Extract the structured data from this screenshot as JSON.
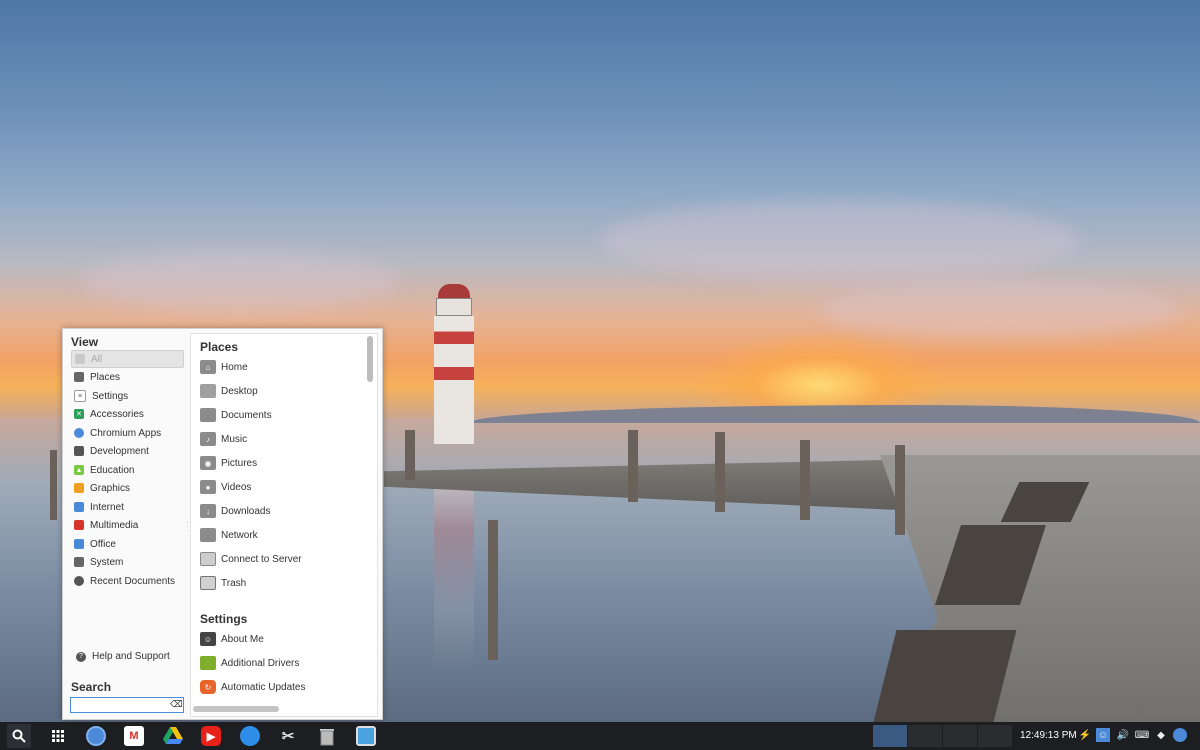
{
  "menu": {
    "view_title": "View",
    "view_items": [
      {
        "label": "All",
        "icon": "all-icon",
        "color": "#c9c9c9"
      },
      {
        "label": "Places",
        "icon": "folder-icon",
        "color": "#666666"
      },
      {
        "label": "Settings",
        "icon": "settings-icon",
        "color": "#8a8a8a"
      },
      {
        "label": "Accessories",
        "icon": "accessories-icon",
        "color": "#2e9e5b"
      },
      {
        "label": "Chromium Apps",
        "icon": "chromium-icon",
        "color": "#4a8ad9"
      },
      {
        "label": "Development",
        "icon": "development-icon",
        "color": "#555555"
      },
      {
        "label": "Education",
        "icon": "education-icon",
        "color": "#7ac943"
      },
      {
        "label": "Graphics",
        "icon": "graphics-icon",
        "color": "#f0a020"
      },
      {
        "label": "Internet",
        "icon": "internet-icon",
        "color": "#4a8ad9"
      },
      {
        "label": "Multimedia",
        "icon": "multimedia-icon",
        "color": "#d9342b"
      },
      {
        "label": "Office",
        "icon": "office-icon",
        "color": "#4a8ad9"
      },
      {
        "label": "System",
        "icon": "system-icon",
        "color": "#666666"
      },
      {
        "label": "Recent Documents",
        "icon": "recent-icon",
        "color": "#555555"
      }
    ],
    "help_label": "Help and Support",
    "search_label": "Search",
    "search_value": "",
    "places_title": "Places",
    "places": [
      {
        "label": "Home",
        "icon": "home-icon"
      },
      {
        "label": "Desktop",
        "icon": "desktop-icon"
      },
      {
        "label": "Documents",
        "icon": "documents-icon"
      },
      {
        "label": "Music",
        "icon": "music-icon"
      },
      {
        "label": "Pictures",
        "icon": "pictures-icon"
      },
      {
        "label": "Videos",
        "icon": "videos-icon"
      },
      {
        "label": "Downloads",
        "icon": "downloads-icon"
      },
      {
        "label": "Network",
        "icon": "network-icon"
      },
      {
        "label": "Connect to Server",
        "icon": "server-icon"
      },
      {
        "label": "Trash",
        "icon": "trash-icon"
      }
    ],
    "settings_title": "Settings",
    "settings": [
      {
        "label": "About Me",
        "icon": "about-me-icon"
      },
      {
        "label": "Additional Drivers",
        "icon": "drivers-icon"
      },
      {
        "label": "Automatic Updates",
        "icon": "updates-icon"
      }
    ]
  },
  "taskbar": {
    "apps": [
      {
        "name": "chromium-icon",
        "color": "#4a8ad9"
      },
      {
        "name": "gmail-icon",
        "color": "#d9342b"
      },
      {
        "name": "google-drive-icon",
        "color": "#f4c20d"
      },
      {
        "name": "youtube-icon",
        "color": "#e62117"
      },
      {
        "name": "files-icon",
        "color": "#2e8de6"
      },
      {
        "name": "scissors-icon",
        "color": "#aaaaaa"
      },
      {
        "name": "trash-icon",
        "color": "#bbbbbb"
      },
      {
        "name": "window-icon",
        "color": "#4aa3df"
      }
    ],
    "clock": "12:49:13 PM"
  }
}
